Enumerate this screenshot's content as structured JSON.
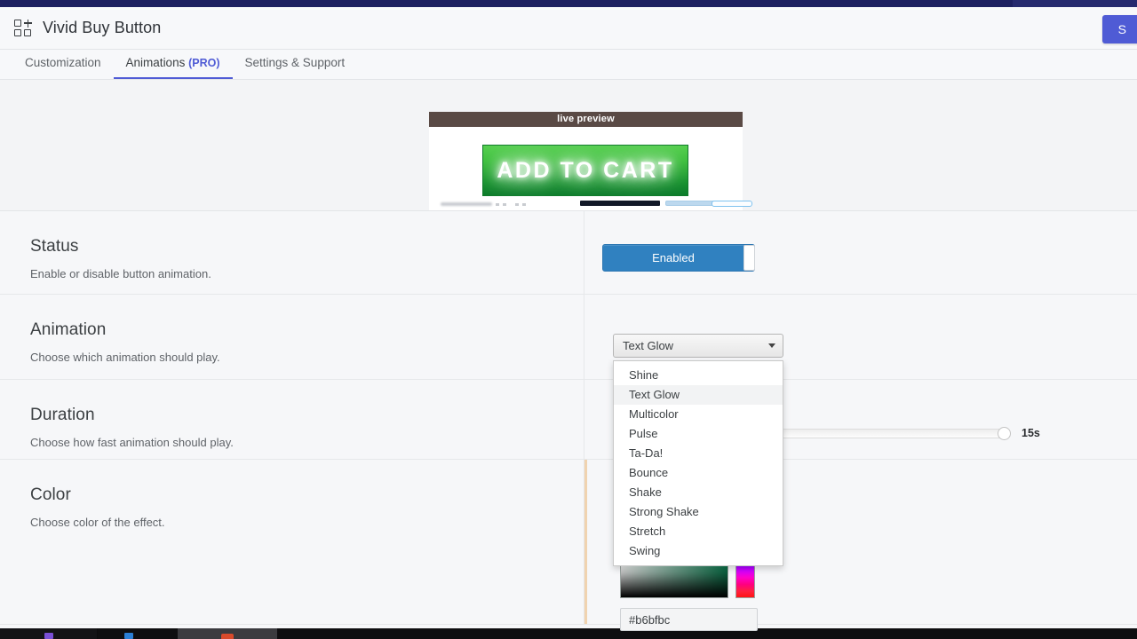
{
  "app": {
    "title": "Vivid Buy Button",
    "logo_icon": "grid-plus-icon",
    "save_button": "S"
  },
  "tabs": [
    {
      "label": "Customization",
      "pro": "",
      "active": false
    },
    {
      "label": "Animations ",
      "pro": "(PRO)",
      "active": true
    },
    {
      "label": "Settings & Support",
      "pro": "",
      "active": false
    }
  ],
  "preview": {
    "header": "live preview",
    "button_label": "ADD TO CART",
    "button_color": "#2fb83c",
    "glow_color": "#ffffff"
  },
  "sections": {
    "status": {
      "title": "Status",
      "desc": "Enable or disable button animation.",
      "toggle_label": "Enabled",
      "toggle_on": true,
      "toggle_color": "#3081c0"
    },
    "animation": {
      "title": "Animation",
      "desc": "Choose which animation should play.",
      "selected": "Text Glow",
      "options": [
        "Shine",
        "Text Glow",
        "Multicolor",
        "Pulse",
        "Ta-Da!",
        "Bounce",
        "Shake",
        "Strong Shake",
        "Stretch",
        "Swing"
      ]
    },
    "duration": {
      "title": "Duration",
      "desc": "Choose how fast animation should play.",
      "value": "15s"
    },
    "color": {
      "title": "Color",
      "desc": "Choose color of the effect.",
      "hex": "#b6bfbc"
    }
  }
}
